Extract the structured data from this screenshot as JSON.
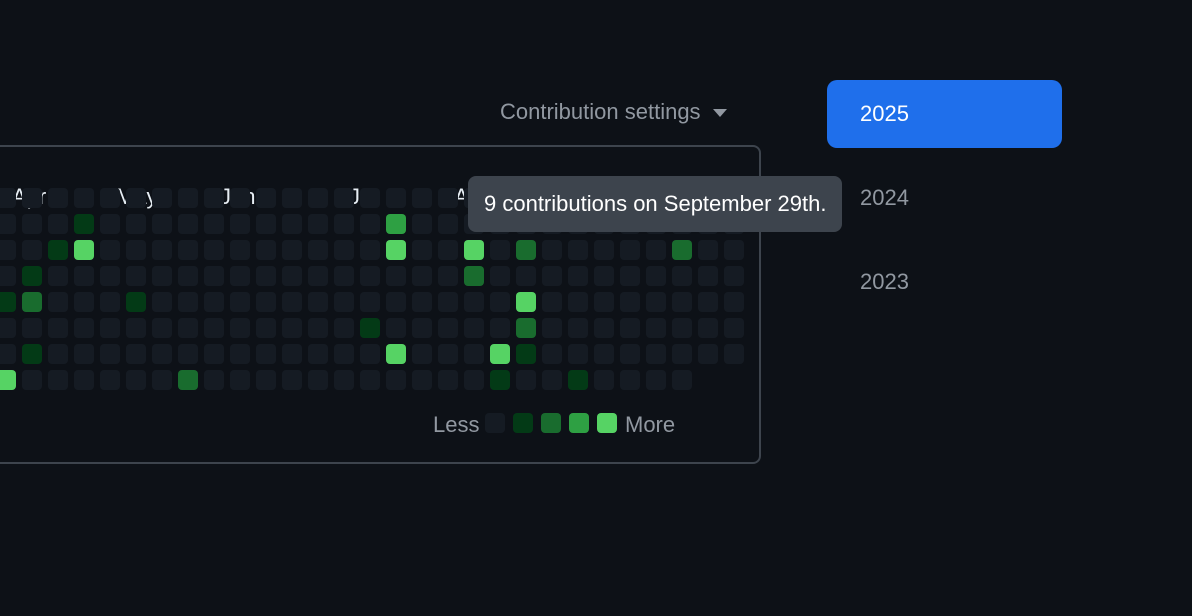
{
  "settings": {
    "label": "Contribution settings"
  },
  "graph": {
    "months": [
      "Apr",
      "May",
      "Jun",
      "Jul",
      "A"
    ],
    "level_colors": [
      "#151b23",
      "#033a16",
      "#196c2e",
      "#2ea043",
      "#56d364"
    ],
    "cells": [
      [
        0,
        0,
        0,
        0,
        0,
        0,
        0,
        0,
        0,
        0,
        0,
        0,
        0,
        0,
        0,
        0,
        0,
        0,
        0,
        0,
        0,
        0,
        0,
        0,
        0,
        0,
        0,
        0,
        0
      ],
      [
        0,
        0,
        0,
        1,
        0,
        0,
        0,
        0,
        0,
        0,
        0,
        0,
        0,
        0,
        0,
        3,
        0,
        0,
        0,
        0,
        0,
        0,
        0,
        0,
        0,
        0,
        0,
        0,
        0
      ],
      [
        0,
        0,
        1,
        4,
        0,
        0,
        0,
        0,
        0,
        0,
        0,
        0,
        0,
        0,
        0,
        4,
        0,
        0,
        4,
        0,
        2,
        0,
        0,
        0,
        0,
        0,
        2,
        0,
        0
      ],
      [
        0,
        1,
        0,
        0,
        0,
        0,
        0,
        0,
        0,
        0,
        0,
        0,
        0,
        0,
        0,
        0,
        0,
        0,
        2,
        0,
        0,
        0,
        0,
        0,
        0,
        0,
        0,
        0,
        0
      ],
      [
        1,
        2,
        0,
        0,
        0,
        1,
        0,
        0,
        0,
        0,
        0,
        0,
        0,
        0,
        0,
        0,
        0,
        0,
        0,
        0,
        4,
        0,
        0,
        0,
        0,
        0,
        0,
        0,
        0
      ],
      [
        0,
        0,
        0,
        0,
        0,
        0,
        0,
        0,
        0,
        0,
        0,
        0,
        0,
        0,
        1,
        0,
        0,
        0,
        0,
        0,
        2,
        0,
        0,
        0,
        0,
        0,
        0,
        0,
        0
      ],
      [
        0,
        1,
        0,
        0,
        0,
        0,
        0,
        0,
        0,
        0,
        0,
        0,
        0,
        0,
        0,
        4,
        0,
        0,
        0,
        4,
        1,
        0,
        0,
        0,
        0,
        0,
        0,
        0,
        0
      ],
      [
        4,
        0,
        0,
        0,
        0,
        0,
        0,
        2,
        0,
        0,
        0,
        0,
        0,
        0,
        0,
        0,
        0,
        0,
        0,
        1,
        0,
        0,
        1,
        0,
        0,
        0,
        0
      ]
    ],
    "legend": {
      "less": "Less",
      "more": "More"
    }
  },
  "tooltip": {
    "text": "9 contributions on September 29th."
  },
  "years": [
    {
      "label": "2025",
      "active": true
    },
    {
      "label": "2024",
      "active": false
    },
    {
      "label": "2023",
      "active": false
    }
  ]
}
